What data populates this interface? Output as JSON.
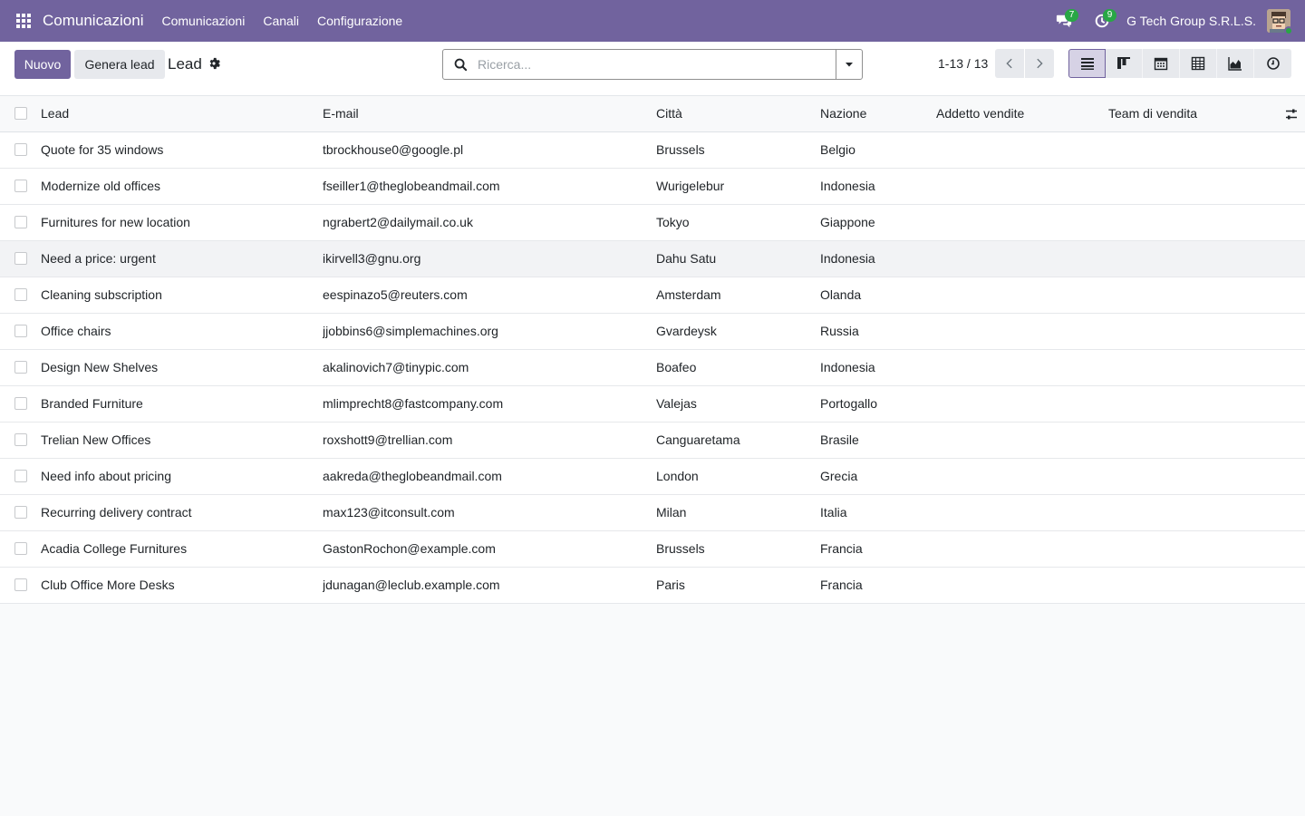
{
  "navbar": {
    "app_name": "Comunicazioni",
    "menu": [
      "Comunicazioni",
      "Canali",
      "Configurazione"
    ],
    "messages_badge": "7",
    "activities_badge": "9",
    "company": "G Tech Group S.R.L.S."
  },
  "control_panel": {
    "new_label": "Nuovo",
    "generate_label": "Genera lead",
    "title": "Lead",
    "search_placeholder": "Ricerca...",
    "pager": "1-13 / 13"
  },
  "table": {
    "columns": {
      "lead": "Lead",
      "email": "E-mail",
      "city": "Città",
      "country": "Nazione",
      "salesperson": "Addetto vendite",
      "team": "Team di vendita"
    },
    "rows": [
      {
        "lead": "Quote for 35 windows",
        "email": "tbrockhouse0@google.pl",
        "city": "Brussels",
        "country": "Belgio",
        "salesperson": "",
        "team": ""
      },
      {
        "lead": "Modernize old offices",
        "email": "fseiller1@theglobeandmail.com",
        "city": "Wurigelebur",
        "country": "Indonesia",
        "salesperson": "",
        "team": ""
      },
      {
        "lead": "Furnitures for new location",
        "email": "ngrabert2@dailymail.co.uk",
        "city": "Tokyo",
        "country": "Giappone",
        "salesperson": "",
        "team": ""
      },
      {
        "lead": "Need a price: urgent",
        "email": "ikirvell3@gnu.org",
        "city": "Dahu Satu",
        "country": "Indonesia",
        "salesperson": "",
        "team": ""
      },
      {
        "lead": "Cleaning subscription",
        "email": "eespinazo5@reuters.com",
        "city": "Amsterdam",
        "country": "Olanda",
        "salesperson": "",
        "team": ""
      },
      {
        "lead": "Office chairs",
        "email": "jjobbins6@simplemachines.org",
        "city": "Gvardeysk",
        "country": "Russia",
        "salesperson": "",
        "team": ""
      },
      {
        "lead": "Design New Shelves",
        "email": "akalinovich7@tinypic.com",
        "city": "Boafeo",
        "country": "Indonesia",
        "salesperson": "",
        "team": ""
      },
      {
        "lead": "Branded Furniture",
        "email": "mlimprecht8@fastcompany.com",
        "city": "Valejas",
        "country": "Portogallo",
        "salesperson": "",
        "team": ""
      },
      {
        "lead": "Trelian New Offices",
        "email": "roxshott9@trellian.com",
        "city": "Canguaretama",
        "country": "Brasile",
        "salesperson": "",
        "team": ""
      },
      {
        "lead": "Need info about pricing",
        "email": "aakreda@theglobeandmail.com",
        "city": "London",
        "country": "Grecia",
        "salesperson": "",
        "team": ""
      },
      {
        "lead": "Recurring delivery contract",
        "email": "max123@itconsult.com",
        "city": "Milan",
        "country": "Italia",
        "salesperson": "",
        "team": ""
      },
      {
        "lead": "Acadia College Furnitures",
        "email": "GastonRochon@example.com",
        "city": "Brussels",
        "country": "Francia",
        "salesperson": "",
        "team": ""
      },
      {
        "lead": "Club Office More Desks",
        "email": "jdunagan@leclub.example.com",
        "city": "Paris",
        "country": "Francia",
        "salesperson": "",
        "team": ""
      }
    ]
  },
  "colors": {
    "brand": "#71639e",
    "badge": "#28a745"
  }
}
